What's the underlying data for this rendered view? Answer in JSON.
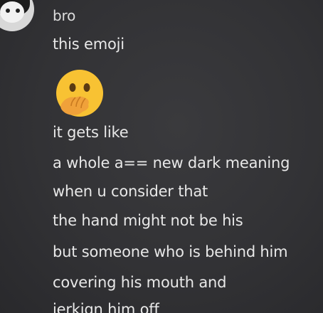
{
  "message": {
    "author": "bro",
    "lines": [
      "this emoji",
      "it gets like",
      "a whole a== new dark meaning",
      "when u consider that",
      "the hand might not be his",
      "but someone who is behind him",
      "covering his mouth and",
      "jerkign him off"
    ],
    "emoji_name": "face-with-hand-over-mouth-emoji"
  },
  "colors": {
    "background": "#323235",
    "text": "#e8e8e8",
    "emoji_face": "#f8c233",
    "emoji_hand": "#f0a13a"
  }
}
